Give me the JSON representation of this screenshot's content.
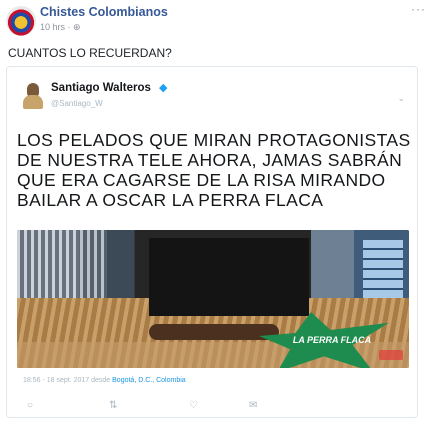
{
  "post": {
    "page_name": "Chistes Colombianos",
    "time": "10 hrs",
    "privacy_icon": "globe-icon",
    "more_glyph": "···",
    "caption": "CUANTOS LO RECUERDAN?"
  },
  "tweet": {
    "author_name": "Santiago Walteros",
    "verified_glyph": "◆",
    "handle": "@Santiago_W",
    "chevron_glyph": "⌄",
    "text": "LOS PELADOS QUE MIRAN PROTAGONISTAS DE NUESTRA TELE AHORA, JAMAS  SABRÁN QUE ERA CAGARSE DE LA RISA MIRANDO BAILAR A OSCAR LA PERRA FLACA",
    "media_overlay_text": "LA PERRA FLACA",
    "date": "18:56 - 18 sept. 2017 desde",
    "location": "Bogotá, D.C., Colombia",
    "actions": {
      "reply_glyph": "○",
      "retweet_glyph": "⇅",
      "like_glyph": "♡",
      "dm_glyph": "✉"
    }
  },
  "colors": {
    "link_blue": "#365899",
    "twitter_blue": "#1da1f2",
    "muted": "#90949c"
  }
}
